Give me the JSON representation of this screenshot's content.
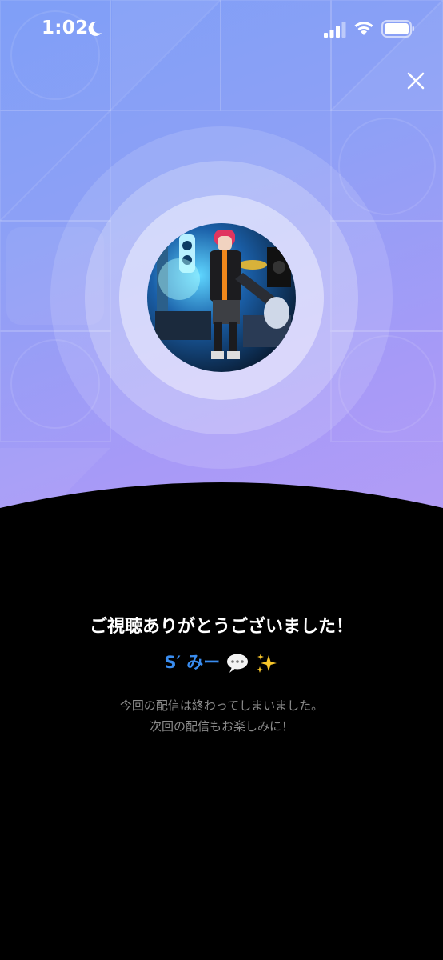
{
  "status_bar": {
    "time": "1:02",
    "moon_icon": "moon-icon",
    "signal_icon": "cellular-signal-icon",
    "wifi_icon": "wifi-icon",
    "battery_icon": "battery-icon"
  },
  "header": {
    "close_icon": "close-icon"
  },
  "colors": {
    "gradient_start": "#7f9ff7",
    "gradient_end": "#b79df6",
    "streamer_name": "#3a8df0",
    "title": "#ffffff",
    "message": "#8a8a8a",
    "background": "#000000"
  },
  "main": {
    "title": "ご視聴ありがとうございました！",
    "streamer_name": "S′ みー",
    "streamer_emojis": [
      "speech-bubble-icon",
      "sparkles-icon"
    ],
    "message_line1": "今回の配信は終わってしまいました。",
    "message_line2": "次回の配信もお楽しみに！"
  }
}
